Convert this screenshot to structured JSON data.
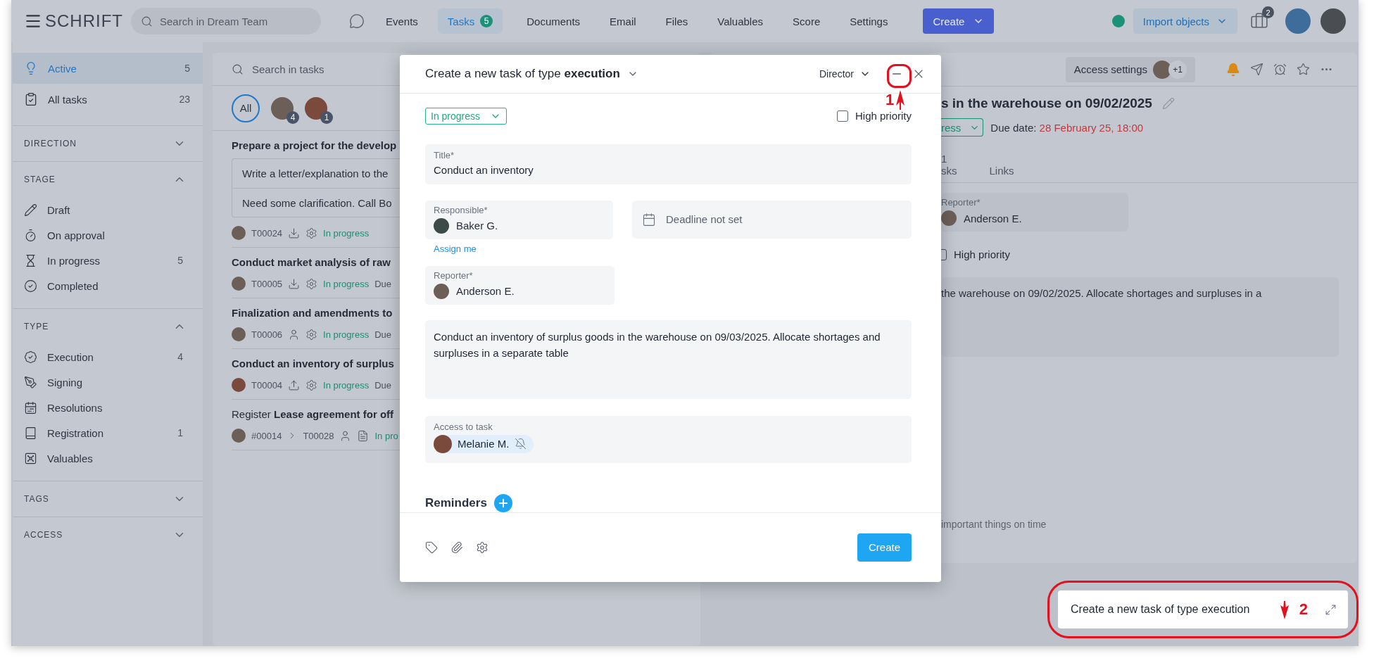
{
  "topbar": {
    "logo": "SCHRIFT",
    "search": {
      "placeholder": "Search in Dream Team"
    },
    "nav": [
      {
        "label": "Events",
        "selected": false
      },
      {
        "label": "Tasks",
        "selected": true,
        "badge": "5"
      },
      {
        "label": "Documents",
        "selected": false
      },
      {
        "label": "Email",
        "selected": false
      },
      {
        "label": "Files",
        "selected": false
      },
      {
        "label": "Valuables",
        "selected": false
      },
      {
        "label": "Score",
        "selected": false
      },
      {
        "label": "Settings",
        "selected": false
      }
    ],
    "create_button": "Create",
    "import_button": "Import objects",
    "briefcase_badge": "2"
  },
  "sidebar": {
    "items": [
      {
        "label": "Active",
        "count": "5",
        "selected": true
      },
      {
        "label": "All tasks",
        "count": "23",
        "selected": false
      }
    ],
    "sections": [
      {
        "title": "DIRECTION",
        "expanded": false
      },
      {
        "title": "STAGE",
        "expanded": true,
        "items": [
          {
            "label": "Draft"
          },
          {
            "label": "On approval"
          },
          {
            "label": "In progress",
            "count": "5"
          },
          {
            "label": "Completed"
          }
        ]
      },
      {
        "title": "TYPE",
        "expanded": true,
        "items": [
          {
            "label": "Execution",
            "count": "4"
          },
          {
            "label": "Signing"
          },
          {
            "label": "Resolutions"
          },
          {
            "label": "Registration",
            "count": "1"
          },
          {
            "label": "Valuables"
          }
        ]
      },
      {
        "title": "TAGS",
        "expanded": false
      },
      {
        "title": "ACCESS",
        "expanded": false
      }
    ]
  },
  "task_list": {
    "search": {
      "placeholder": "Search in tasks"
    },
    "filters": [
      {
        "label": "All",
        "selected": true
      },
      {
        "badge": "4",
        "selected": false
      },
      {
        "badge": "1",
        "selected": false
      }
    ],
    "tasks": [
      {
        "title": "Prepare a project for the develop",
        "subitems": [
          "Write a letter/explanation to the",
          "Need some clarification. Call Bo"
        ],
        "code": "T00024",
        "status": "In progress"
      },
      {
        "title": "Conduct market analysis of raw",
        "code": "T00005",
        "status": "In progress",
        "due": "Due"
      },
      {
        "title": "Finalization and amendments to",
        "code": "T00006",
        "status": "In progress",
        "due": "Due"
      },
      {
        "title": "Conduct an inventory of surplus",
        "code": "T00004",
        "status": "In progress",
        "due": "Due"
      },
      {
        "title": "Register **Lease agreement for off**",
        "parent": "#00014",
        "code": "T00028",
        "status": "In pro"
      }
    ]
  },
  "task_detail": {
    "access_button": "Access settings",
    "access_extra": "+1",
    "title": "s in the warehouse on 09/02/2025",
    "status": "ress",
    "due_label": "Due date:",
    "due_date": "28 February 25, 18:00",
    "tabs": [
      {
        "count": "1",
        "label": "sks"
      },
      {
        "label": "Links"
      }
    ],
    "reporter": {
      "label": "Reporter*",
      "name": "Anderson E."
    },
    "high_priority": {
      "label": "High priority",
      "checked": false
    },
    "description": "the warehouse on 09/02/2025. Allocate shortages and surpluses in a",
    "hint": "important things on time"
  },
  "modal": {
    "title": "Create a new task of type **execution**",
    "role": "Director",
    "status": "In progress",
    "high_priority": {
      "label": "High priority",
      "checked": false
    },
    "title_field": {
      "label": "Title*",
      "value": "Conduct an inventory"
    },
    "responsible": {
      "label": "Responsible*",
      "name": "Baker G.",
      "assign_link": "Assign me"
    },
    "deadline": {
      "placeholder": "Deadline not set"
    },
    "reporter": {
      "label": "Reporter*",
      "name": "Anderson E."
    },
    "description": "Conduct an inventory of surplus goods in the warehouse on 09/03/2025. Allocate shortages and surpluses in a separate table",
    "access": {
      "label": "Access to task",
      "people": [
        {
          "name": "Melanie M."
        }
      ]
    },
    "reminders": "Reminders",
    "create_button": "Create"
  },
  "minimized": {
    "title": "Create a new task of type execution"
  },
  "annotations": [
    {
      "label": "1"
    },
    {
      "label": "2"
    }
  ]
}
